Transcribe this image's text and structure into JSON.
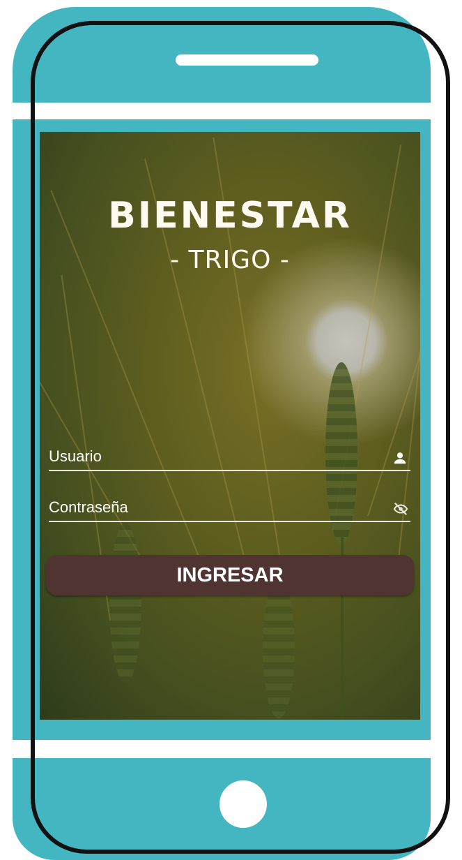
{
  "app": {
    "brand": "BIENESTAR",
    "subtitle": "- TRIGO -"
  },
  "form": {
    "username_label": "Usuario",
    "username_icon": "person-icon",
    "password_label": "Contraseña",
    "password_icon": "eye-off-icon",
    "submit_label": "INGRESAR"
  },
  "colors": {
    "phone_teal": "#43b6c1",
    "button_brown": "#4f3431",
    "text": "#ffffff"
  }
}
